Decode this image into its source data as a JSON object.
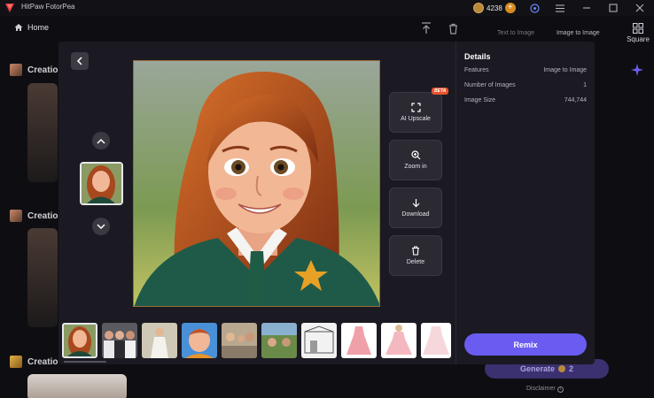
{
  "app": {
    "title": "HitPaw FotorPea",
    "coins": "4238"
  },
  "nav": {
    "home": "Home"
  },
  "background": {
    "creation_labels": [
      "Creatio",
      "Creatio",
      "Creatio"
    ],
    "right_tabs": [
      "Text to Image",
      "Image to Image"
    ],
    "square_label": "Square",
    "generate": "Generate",
    "generate_cost": "2",
    "disclaimer": "Disclaimer"
  },
  "modal": {
    "actions": {
      "upscale": "AI Upscale",
      "beta": "BETA",
      "zoom_in": "Zoom in",
      "download": "Download",
      "delete": "Delete"
    },
    "details": {
      "title": "Details",
      "rows": [
        {
          "label": "Features",
          "value": "Image to Image"
        },
        {
          "label": "Number of Images",
          "value": "1"
        },
        {
          "label": "Image Size",
          "value": "744,744"
        }
      ]
    },
    "remix": "Remix"
  },
  "icons": [
    "back-arrow-icon",
    "chevron-up-icon",
    "chevron-down-icon",
    "expand-icon",
    "zoom-in-icon",
    "download-icon",
    "trash-icon",
    "home-icon",
    "upload-icon",
    "coin-icon",
    "plus-icon",
    "settings-icon",
    "menu-icon",
    "minimize-icon",
    "maximize-icon",
    "close-icon",
    "grid-icon",
    "info-icon"
  ],
  "colors": {
    "accent": "#6a5cf0",
    "beta": "#e8542c",
    "modal_bg": "#1b1a22"
  }
}
